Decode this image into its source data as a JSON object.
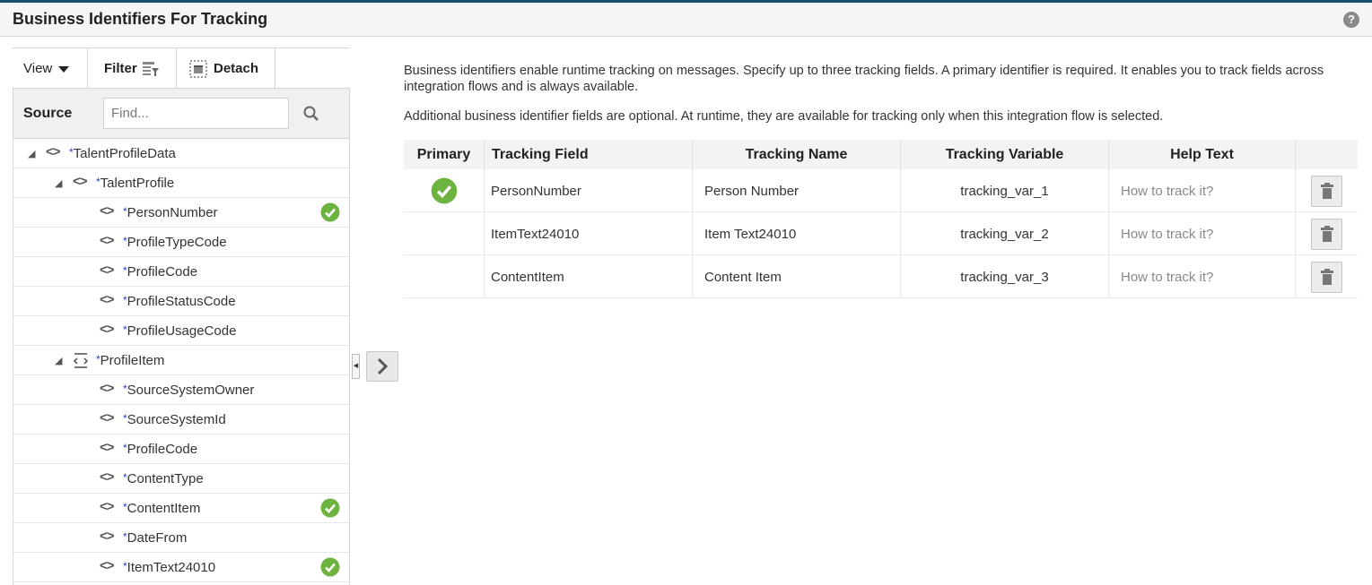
{
  "header": {
    "title": "Business Identifiers For Tracking",
    "help_icon": "?"
  },
  "toolbar": {
    "view_label": "View",
    "filter_label": "Filter",
    "detach_label": "Detach"
  },
  "source": {
    "label": "Source",
    "find_placeholder": "Find..."
  },
  "tree": [
    {
      "label": "TalentProfileData",
      "required": "*",
      "level": 0,
      "kind": "element",
      "expanded": true,
      "selected": false
    },
    {
      "label": "TalentProfile",
      "required": "*",
      "level": 1,
      "kind": "element",
      "expanded": true,
      "selected": false
    },
    {
      "label": "PersonNumber",
      "required": "*",
      "level": 2,
      "kind": "element",
      "selected": true
    },
    {
      "label": "ProfileTypeCode",
      "required": "*",
      "level": 2,
      "kind": "element",
      "selected": false
    },
    {
      "label": "ProfileCode",
      "required": "*",
      "level": 2,
      "kind": "element",
      "selected": false
    },
    {
      "label": "ProfileStatusCode",
      "required": "*",
      "level": 2,
      "kind": "element",
      "selected": false
    },
    {
      "label": "ProfileUsageCode",
      "required": "*",
      "level": 2,
      "kind": "element",
      "selected": false
    },
    {
      "label": "ProfileItem",
      "required": "*",
      "level": 1,
      "kind": "repeating",
      "expanded": true,
      "selected": false
    },
    {
      "label": "SourceSystemOwner",
      "required": "*",
      "level": 2,
      "kind": "element",
      "selected": false
    },
    {
      "label": "SourceSystemId",
      "required": "*",
      "level": 2,
      "kind": "element",
      "selected": false
    },
    {
      "label": "ProfileCode",
      "required": "*",
      "level": 2,
      "kind": "element",
      "selected": false
    },
    {
      "label": "ContentType",
      "required": "*",
      "level": 2,
      "kind": "element",
      "selected": false
    },
    {
      "label": "ContentItem",
      "required": "*",
      "level": 2,
      "kind": "element",
      "selected": true
    },
    {
      "label": "DateFrom",
      "required": "*",
      "level": 2,
      "kind": "element",
      "selected": false
    },
    {
      "label": "ItemText24010",
      "required": "*",
      "level": 2,
      "kind": "element",
      "selected": true
    }
  ],
  "intro": {
    "line1": "Business identifiers enable runtime tracking on messages. Specify up to three tracking fields. A primary identifier is required. It enables you to track fields across integration flows and is always available.",
    "line2": "Additional business identifier fields are optional. At runtime, they are available for tracking only when this integration flow is selected."
  },
  "grid": {
    "columns": [
      "Primary",
      "Tracking Field",
      "Tracking Name",
      "Tracking Variable",
      "Help Text"
    ],
    "rows": [
      {
        "primary": true,
        "field": "PersonNumber",
        "name": "Person Number",
        "variable": "tracking_var_1",
        "help": "How to track it?"
      },
      {
        "primary": false,
        "field": "ItemText24010",
        "name": "Item Text24010",
        "variable": "tracking_var_2",
        "help": "How to track it?"
      },
      {
        "primary": false,
        "field": "ContentItem",
        "name": "Content Item",
        "variable": "tracking_var_3",
        "help": "How to track it?"
      }
    ]
  },
  "colors": {
    "accent_green": "#6db33f",
    "required_star": "#2d3bcf",
    "top_line": "#1b4f72"
  },
  "icons": {
    "filter": "filter-icon",
    "detach": "detach-icon",
    "search": "search-icon",
    "check": "check-icon",
    "trash": "trash-icon",
    "element": "element-code-icon",
    "repeating": "repeating-element-icon"
  }
}
